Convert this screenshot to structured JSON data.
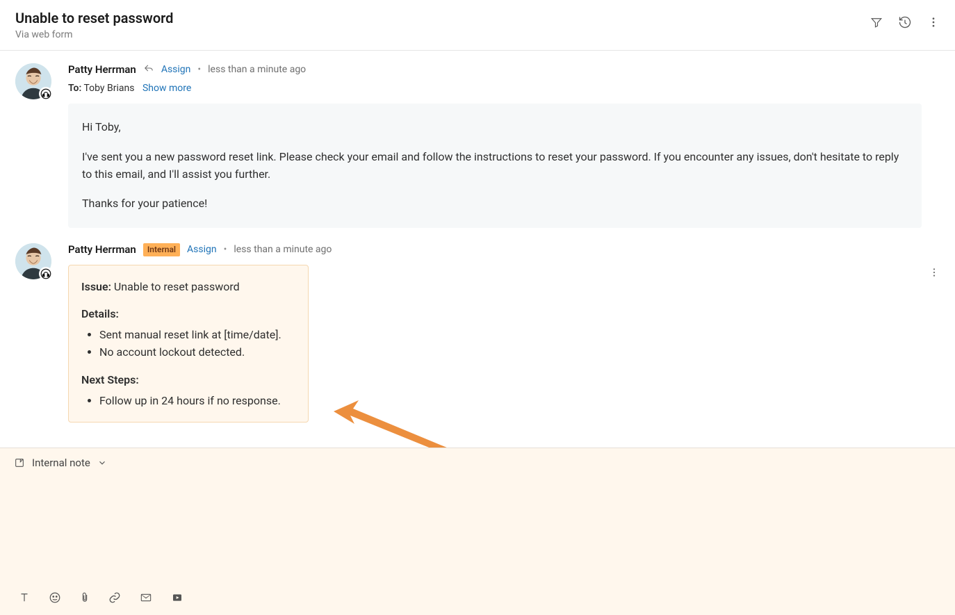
{
  "header": {
    "title": "Unable to reset password",
    "subtitle": "Via web form"
  },
  "messages": [
    {
      "sender": "Patty Herrman",
      "assign_label": "Assign",
      "time": "less than a minute ago",
      "to_label": "To:",
      "to_name": "Toby Brians",
      "show_more_label": "Show more",
      "body_p1": "Hi Toby,",
      "body_p2": "I've sent you a new password reset link. Please check your email and follow the instructions to reset your password. If you encounter any issues, don't hesitate to reply to this email, and I'll assist you further.",
      "body_p3": "Thanks for your patience!"
    },
    {
      "sender": "Patty Herrman",
      "internal_label": "Internal",
      "assign_label": "Assign",
      "time": "less than a minute ago",
      "note": {
        "issue_label": "Issue:",
        "issue_text": "Unable to reset password",
        "details_label": "Details:",
        "details_items": [
          "Sent manual reset link at [time/date].",
          "No account lockout detected."
        ],
        "next_steps_label": "Next Steps:",
        "next_steps_items": [
          "Follow up in 24 hours if no response."
        ]
      }
    }
  ],
  "composer": {
    "mode_label": "Internal note"
  }
}
